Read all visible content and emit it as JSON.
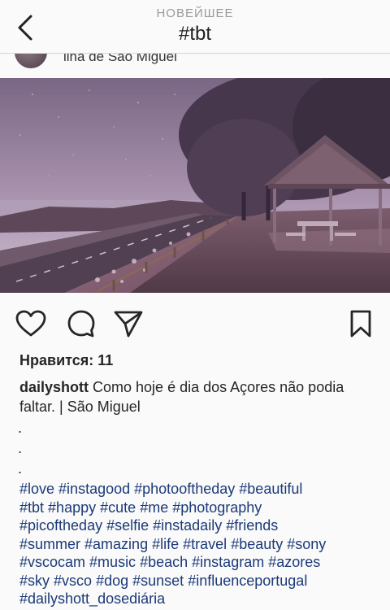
{
  "header": {
    "subtitle": "НОВЕЙШЕЕ",
    "title": "#tbt"
  },
  "post": {
    "location": "ilha de São Miguel",
    "likes_text": "Нравится: 11",
    "username": "dailyshott",
    "caption_text": " Como hoje é dia dos Açores não podia faltar. | São Miguel",
    "dots": [
      ".",
      ".",
      "."
    ],
    "hashtags": [
      "#love",
      "#instagood",
      "#photooftheday",
      "#beautiful",
      "#tbt",
      "#happy",
      "#cute",
      "#me",
      "#photography",
      "#picoftheday",
      "#selfie",
      "#instadaily",
      "#friends",
      "#summer",
      "#amazing",
      "#life",
      "#travel",
      "#beauty",
      "#sony",
      "#vscocam",
      "#music",
      "#beach",
      "#instagram",
      "#azores",
      "#sky",
      "#vsco",
      "#dog",
      "#sunset",
      "#influenceportugal",
      "#dailyshott_dosediária"
    ]
  },
  "icons": {
    "back": "chevron-left-icon",
    "like": "heart-outline-icon",
    "comment": "comment-bubble-icon",
    "share": "paper-plane-icon",
    "save": "bookmark-icon"
  },
  "colors": {
    "hashtag": "#1b3a78",
    "text": "#262626",
    "muted": "#9a9a9a"
  }
}
